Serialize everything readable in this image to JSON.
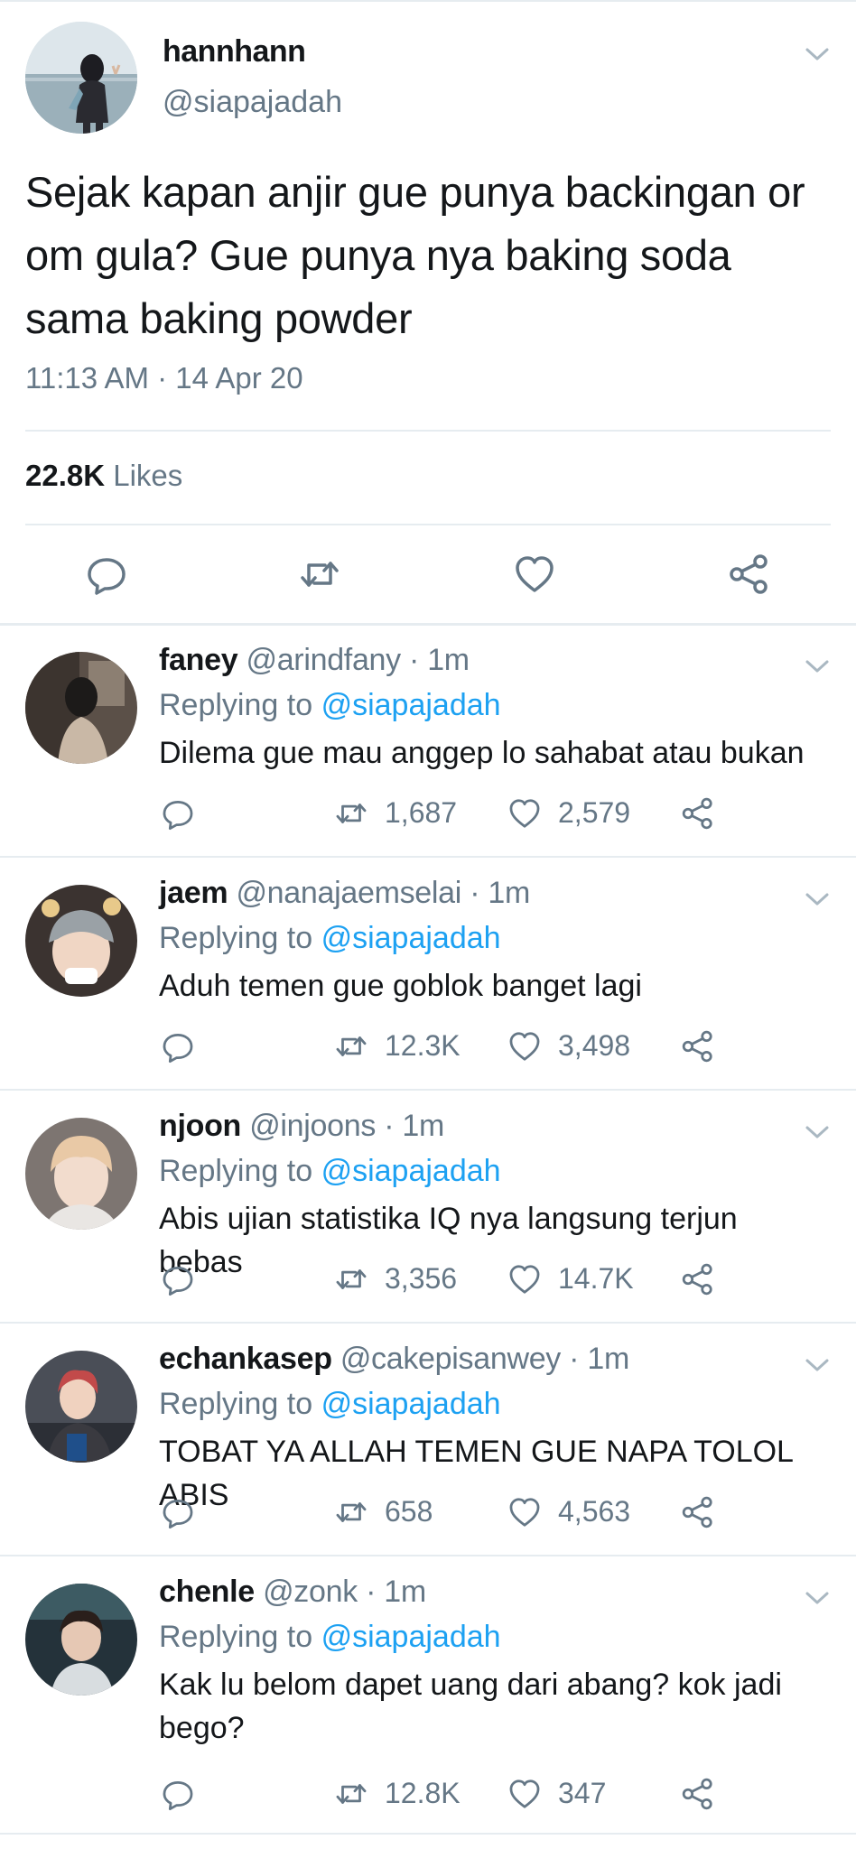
{
  "tweet": {
    "display_name": "hannhann",
    "handle": "@siapajadah",
    "text": "Sejak kapan anjir gue punya backingan or om gula? Gue punya nya baking soda sama baking powder",
    "timestamp": "11:13 AM · 14 Apr 20",
    "likes_count": "22.8K",
    "likes_label": "Likes",
    "actions": [
      "reply-icon",
      "retweet-icon",
      "like-icon",
      "share-icon"
    ]
  },
  "replies": [
    {
      "display_name": "faney",
      "handle": "@arindfany",
      "time": "· 1m",
      "replying_prefix": "Replying to",
      "replying_to": "@siapajadah",
      "text": "Dilema gue mau anggep lo sahabat atau bukan",
      "retweets": "1,687",
      "likes": "2,579"
    },
    {
      "display_name": "jaem",
      "handle": "@nanajaemselai",
      "time": "· 1m",
      "replying_prefix": "Replying to",
      "replying_to": "@siapajadah",
      "text": "Aduh temen gue goblok banget lagi",
      "retweets": "12.3K",
      "likes": "3,498"
    },
    {
      "display_name": "njoon",
      "handle": "@injoons",
      "time": "· 1m",
      "replying_prefix": "Replying to",
      "replying_to": "@siapajadah",
      "text": "Abis ujian statistika IQ nya langsung terjun bebas",
      "retweets": "3,356",
      "likes": "14.7K"
    },
    {
      "display_name": "echankasep",
      "handle": "@cakepisanwey",
      "time": "· 1m",
      "replying_prefix": "Replying to",
      "replying_to": "@siapajadah",
      "text": "TOBAT YA ALLAH TEMEN GUE NAPA TOLOL ABIS",
      "retweets": "658",
      "likes": "4,563"
    },
    {
      "display_name": "chenle",
      "handle": "@zonk",
      "time": "· 1m",
      "replying_prefix": "Replying to",
      "replying_to": "@siapajadah",
      "text": "Kak lu belom dapet uang dari abang? kok jadi bego?",
      "retweets": "12.8K",
      "likes": "347"
    }
  ],
  "colors": {
    "text": "#14171a",
    "secondary": "#657786",
    "link": "#1da1f2",
    "divider": "#e6ecf0"
  }
}
